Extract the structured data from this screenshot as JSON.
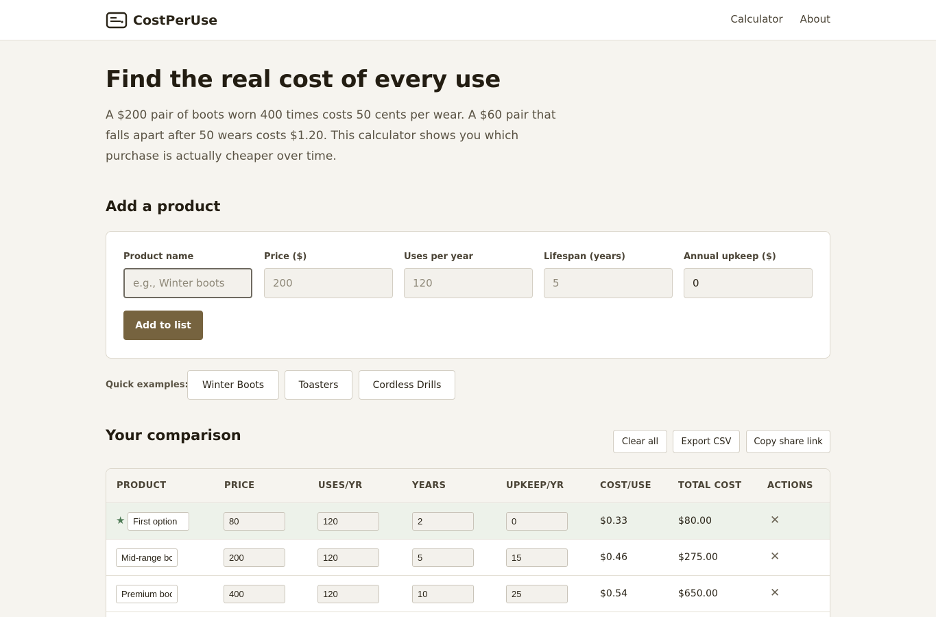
{
  "app": {
    "name": "CostPerUse",
    "nav": [
      "Calculator",
      "About"
    ]
  },
  "hero": {
    "title": "Find the real cost of every use",
    "description": "A $200 pair of boots worn 400 times costs 50 cents per wear. A $60 pair that falls apart after 50 wears costs $1.20. This calculator shows you which purchase is actually cheaper over time."
  },
  "add_product": {
    "title": "Add a product",
    "fields": [
      {
        "label": "Product name",
        "placeholder": "e.g., Winter boots",
        "value": ""
      },
      {
        "label": "Price ($)",
        "placeholder": "200",
        "value": ""
      },
      {
        "label": "Uses per year",
        "placeholder": "120",
        "value": ""
      },
      {
        "label": "Lifespan (years)",
        "placeholder": "5",
        "value": ""
      },
      {
        "label": "Annual upkeep ($)",
        "placeholder": "",
        "value": "0"
      }
    ],
    "button": "Add to list"
  },
  "quick_examples": {
    "label": "Quick examples:",
    "items": [
      "Winter Boots",
      "Toasters",
      "Cordless Drills"
    ]
  },
  "comparison": {
    "title": "Your comparison",
    "actions": [
      "Clear all",
      "Export CSV",
      "Copy share link"
    ],
    "columns": [
      "PRODUCT",
      "PRICE",
      "USES/YR",
      "YEARS",
      "UPKEEP/YR",
      "COST/USE",
      "TOTAL COST",
      "ACTIONS"
    ],
    "rows": [
      {
        "best": true,
        "name": "First option",
        "price": "80",
        "uses": "120",
        "years": "2",
        "upkeep": "0",
        "cost_per_use": "$0.33",
        "total": "$80.00"
      },
      {
        "best": false,
        "name": "Mid-range boots",
        "price": "200",
        "uses": "120",
        "years": "5",
        "upkeep": "15",
        "cost_per_use": "$0.46",
        "total": "$275.00"
      },
      {
        "best": false,
        "name": "Premium boots",
        "price": "400",
        "uses": "120",
        "years": "10",
        "upkeep": "25",
        "cost_per_use": "$0.54",
        "total": "$650.00"
      }
    ]
  },
  "colors": {
    "accent": "#76633f",
    "best_row": "#edf2ea",
    "best_star": "#4d7a55",
    "background": "#f6f4ef"
  },
  "icons": {
    "logo": "wallet-icon",
    "best": "star-icon",
    "remove": "close-icon"
  }
}
